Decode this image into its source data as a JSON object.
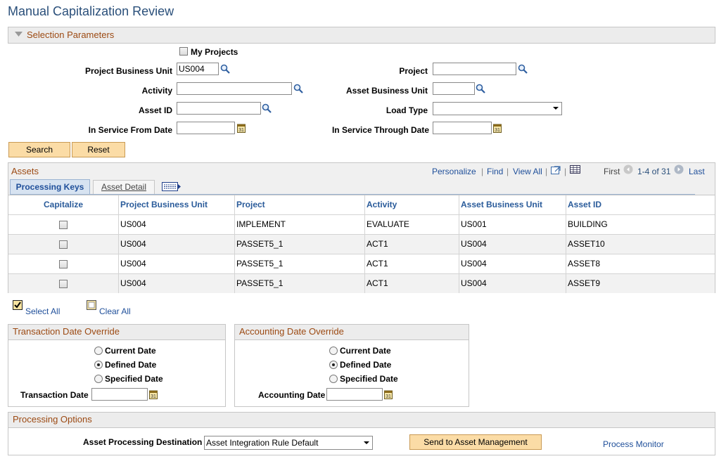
{
  "page_title": "Manual Capitalization Review",
  "selection": {
    "header": "Selection Parameters",
    "my_projects_label": "My Projects",
    "project_bu_label": "Project Business Unit",
    "project_bu_value": "US004",
    "project_label": "Project",
    "project_value": "",
    "activity_label": "Activity",
    "activity_value": "",
    "asset_bu_label": "Asset Business Unit",
    "asset_bu_value": "",
    "asset_id_label": "Asset ID",
    "asset_id_value": "",
    "load_type_label": "Load Type",
    "load_type_value": "",
    "in_service_from_label": "In Service From Date",
    "in_service_from_value": "",
    "in_service_through_label": "In Service Through Date",
    "in_service_through_value": ""
  },
  "buttons": {
    "search": "Search",
    "reset": "Reset"
  },
  "assets": {
    "title": "Assets",
    "nav": {
      "personalize": "Personalize",
      "find": "Find",
      "view_all": "View All",
      "first": "First",
      "range": "1-4 of 31",
      "last": "Last",
      "sep": "|"
    },
    "tabs": {
      "processing_keys": "Processing Keys",
      "asset_detail": "Asset Detail"
    },
    "columns": [
      "Capitalize",
      "Project Business Unit",
      "Project",
      "Activity",
      "Asset Business Unit",
      "Asset ID"
    ],
    "rows": [
      {
        "pbu": "US004",
        "project": "IMPLEMENT",
        "activity": "EVALUATE",
        "abu": "US001",
        "asset_id": "BUILDING"
      },
      {
        "pbu": "US004",
        "project": "PASSET5_1",
        "activity": "ACT1",
        "abu": "US004",
        "asset_id": "ASSET10"
      },
      {
        "pbu": "US004",
        "project": "PASSET5_1",
        "activity": "ACT1",
        "abu": "US004",
        "asset_id": "ASSET8"
      },
      {
        "pbu": "US004",
        "project": "PASSET5_1",
        "activity": "ACT1",
        "abu": "US004",
        "asset_id": "ASSET9"
      }
    ],
    "select_all": "Select All",
    "clear_all": "Clear All"
  },
  "transaction_override": {
    "header": "Transaction Date Override",
    "options": [
      "Current Date",
      "Defined Date",
      "Specified Date"
    ],
    "selected": "Defined Date",
    "date_label": "Transaction Date",
    "date_value": ""
  },
  "accounting_override": {
    "header": "Accounting Date Override",
    "options": [
      "Current Date",
      "Defined Date",
      "Specified Date"
    ],
    "selected": "Defined Date",
    "date_label": "Accounting Date",
    "date_value": ""
  },
  "processing": {
    "header": "Processing Options",
    "destination_label": "Asset Processing Destination",
    "destination_value": "Asset Integration Rule Default",
    "send_button": "Send to Asset Management",
    "process_monitor": "Process Monitor"
  },
  "colors": {
    "section_header_text": "#9c4a13",
    "link": "#1f4f9a",
    "button_bg": "#fbdca6",
    "title": "#2a4f7a"
  }
}
